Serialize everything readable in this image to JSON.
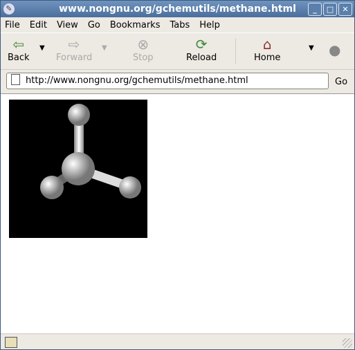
{
  "window": {
    "title": "www.nongnu.org/gchemutils/methane.html"
  },
  "menu": [
    "File",
    "Edit",
    "View",
    "Go",
    "Bookmarks",
    "Tabs",
    "Help"
  ],
  "toolbar": {
    "back": "Back",
    "forward": "Forward",
    "stop": "Stop",
    "reload": "Reload",
    "home": "Home"
  },
  "urlbar": {
    "value": "http://www.nongnu.org/gchemutils/methane.html",
    "go": "Go"
  }
}
